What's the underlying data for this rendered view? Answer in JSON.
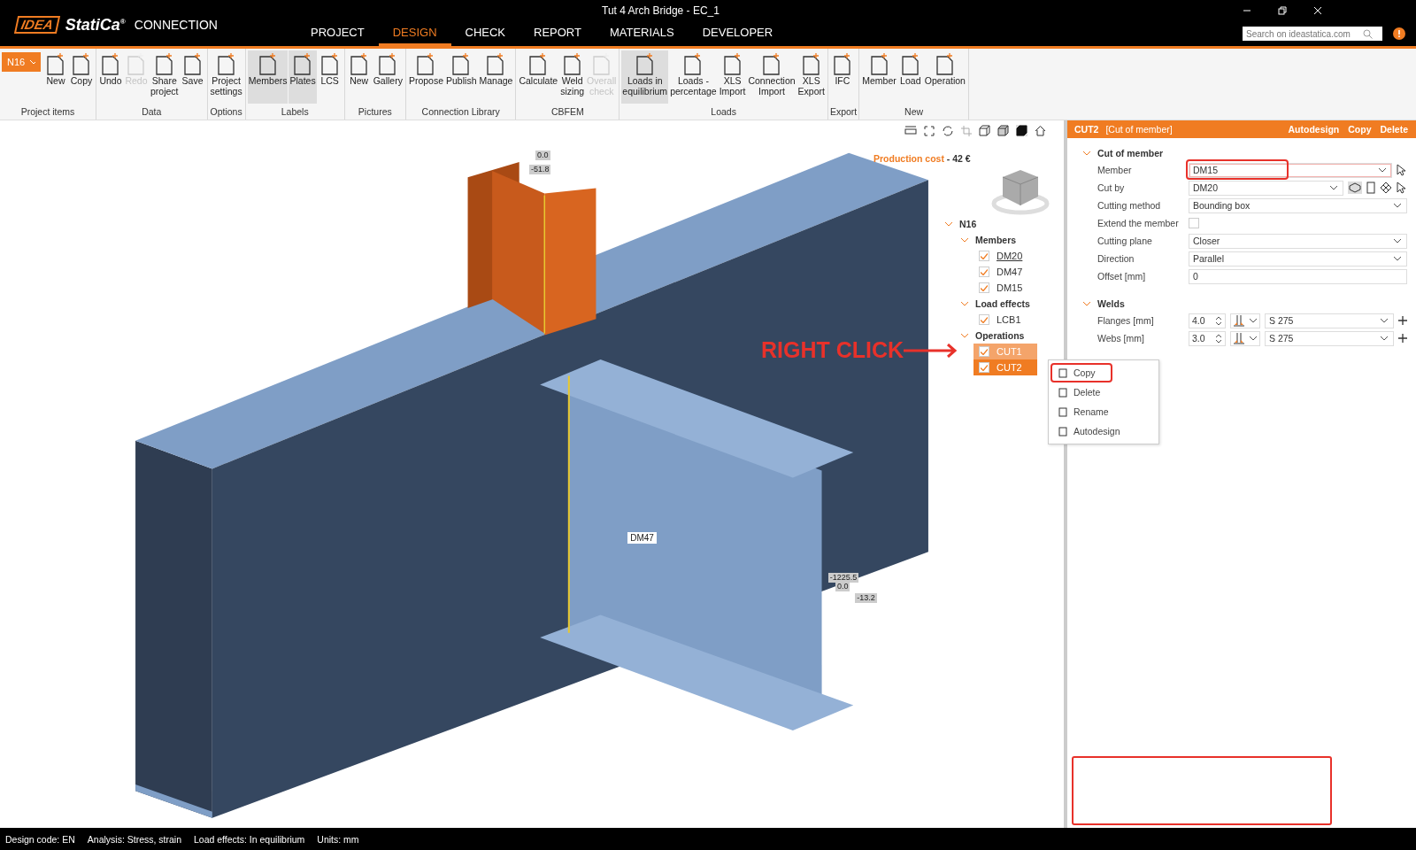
{
  "window": {
    "title": "Tut 4 Arch Bridge - EC_1",
    "logo": {
      "mark": "IDEA",
      "name": "StatiCa",
      "registered": "®",
      "product": "CONNECTION"
    }
  },
  "menu_tabs": [
    {
      "label": "PROJECT",
      "selected": false
    },
    {
      "label": "DESIGN",
      "selected": true
    },
    {
      "label": "CHECK",
      "selected": false
    },
    {
      "label": "REPORT",
      "selected": false
    },
    {
      "label": "MATERIALS",
      "selected": false
    },
    {
      "label": "DEVELOPER",
      "selected": false
    }
  ],
  "search": {
    "placeholder": "Search on ideastatica.com"
  },
  "ribbon": {
    "node": "N16",
    "groups": [
      {
        "label": "Project items",
        "buttons": [
          {
            "label": "New",
            "disabled": false,
            "selected": false
          },
          {
            "label": "Copy",
            "disabled": false,
            "selected": false
          }
        ]
      },
      {
        "label": "Data",
        "buttons": [
          {
            "label": "Undo",
            "disabled": false,
            "selected": false
          },
          {
            "label": "Redo",
            "disabled": true,
            "selected": false
          },
          {
            "label": "Share\nproject",
            "disabled": false,
            "selected": false
          },
          {
            "label": "Save",
            "disabled": false,
            "selected": false
          }
        ]
      },
      {
        "label": "Options",
        "buttons": [
          {
            "label": "Project\nsettings",
            "disabled": false,
            "selected": false
          }
        ]
      },
      {
        "label": "Labels",
        "buttons": [
          {
            "label": "Members",
            "disabled": false,
            "selected": true
          },
          {
            "label": "Plates",
            "disabled": false,
            "selected": true
          },
          {
            "label": "LCS",
            "disabled": false,
            "selected": false
          }
        ]
      },
      {
        "label": "Pictures",
        "buttons": [
          {
            "label": "New",
            "disabled": false,
            "selected": false
          },
          {
            "label": "Gallery",
            "disabled": false,
            "selected": false
          }
        ]
      },
      {
        "label": "Connection Library",
        "buttons": [
          {
            "label": "Propose",
            "disabled": false,
            "selected": false
          },
          {
            "label": "Publish",
            "disabled": false,
            "selected": false
          },
          {
            "label": "Manage",
            "disabled": false,
            "selected": false
          }
        ]
      },
      {
        "label": "CBFEM",
        "buttons": [
          {
            "label": "Calculate",
            "disabled": false,
            "selected": false
          },
          {
            "label": "Weld\nsizing",
            "disabled": false,
            "selected": false
          },
          {
            "label": "Overall\ncheck",
            "disabled": true,
            "selected": false
          }
        ]
      },
      {
        "label": "Loads",
        "buttons": [
          {
            "label": "Loads in\nequilibrium",
            "disabled": false,
            "selected": true
          },
          {
            "label": "Loads -\npercentage",
            "disabled": false,
            "selected": false
          },
          {
            "label": "XLS\nImport",
            "disabled": false,
            "selected": false
          },
          {
            "label": "Connection\nImport",
            "disabled": false,
            "selected": false
          },
          {
            "label": "XLS\nExport",
            "disabled": false,
            "selected": false
          }
        ]
      },
      {
        "label": "Export",
        "buttons": [
          {
            "label": "IFC",
            "disabled": false,
            "selected": false
          }
        ]
      },
      {
        "label": "New",
        "buttons": [
          {
            "label": "Member",
            "disabled": false,
            "selected": false
          },
          {
            "label": "Load",
            "disabled": false,
            "selected": false
          },
          {
            "label": "Operation",
            "disabled": false,
            "selected": false
          }
        ]
      }
    ]
  },
  "viewport": {
    "production_cost": {
      "label": "Production cost",
      "value": "- 42 €"
    },
    "labels": [
      {
        "kind": "dimension",
        "text": "0.0"
      },
      {
        "kind": "dimension",
        "text": "-51.8"
      },
      {
        "kind": "member",
        "text": "DM47"
      },
      {
        "kind": "dimension",
        "text": "-1225.5"
      },
      {
        "kind": "dimension",
        "text": "0.0"
      },
      {
        "kind": "dimension",
        "text": "-13.2"
      }
    ],
    "annotation": {
      "text": "RIGHT CLICK"
    }
  },
  "tree": {
    "label": "N16",
    "expanded": true,
    "groups": [
      {
        "label": "Members",
        "expanded": true,
        "items": [
          {
            "label": "DM20",
            "checked": true,
            "selected": false,
            "focused": false,
            "hovered": true
          },
          {
            "label": "DM47",
            "checked": true,
            "selected": false,
            "focused": false,
            "hovered": false
          },
          {
            "label": "DM15",
            "checked": true,
            "selected": false,
            "focused": false,
            "hovered": false
          }
        ]
      },
      {
        "label": "Load effects",
        "expanded": true,
        "items": [
          {
            "label": "LCB1",
            "checked": true,
            "selected": false,
            "focused": false,
            "hovered": false
          }
        ]
      },
      {
        "label": "Operations",
        "expanded": true,
        "items": [
          {
            "label": "CUT1",
            "checked": true,
            "selected": true,
            "focused": false,
            "hovered": false
          },
          {
            "label": "CUT2",
            "checked": true,
            "selected": true,
            "focused": true,
            "hovered": false
          }
        ]
      }
    ]
  },
  "context_menu": {
    "items": [
      {
        "label": "Copy",
        "highlighted": true
      },
      {
        "label": "Delete",
        "highlighted": false
      },
      {
        "label": "Rename",
        "highlighted": false
      },
      {
        "label": "Autodesign",
        "highlighted": false
      }
    ]
  },
  "panel": {
    "title": "CUT2",
    "subtitle": "[Cut of member]",
    "actions": [
      "Autodesign",
      "Copy",
      "Delete"
    ],
    "sections": [
      {
        "title": "Cut of member",
        "expanded": true,
        "rows": [
          {
            "kind": "select",
            "label": "Member",
            "value": "DM15",
            "highlighted": true,
            "tools": false
          },
          {
            "kind": "select",
            "label": "Cut by",
            "value": "DM20",
            "highlighted": false,
            "tools": true
          },
          {
            "kind": "select",
            "label": "Cutting method",
            "value": "Bounding box",
            "highlighted": false,
            "tools": false
          },
          {
            "kind": "checkbox",
            "label": "Extend the member",
            "checked": false
          },
          {
            "kind": "select",
            "label": "Cutting plane",
            "value": "Closer",
            "highlighted": false,
            "tools": false
          },
          {
            "kind": "select",
            "label": "Direction",
            "value": "Parallel",
            "highlighted": false,
            "tools": false
          },
          {
            "kind": "text",
            "label": "Offset [mm]",
            "value": "0"
          }
        ]
      },
      {
        "title": "Welds",
        "expanded": true,
        "rows": [
          {
            "kind": "weld",
            "label": "Flanges [mm]",
            "size": "4.0",
            "material": "S 275"
          },
          {
            "kind": "weld",
            "label": "Webs [mm]",
            "size": "3.0",
            "material": "S 275"
          }
        ]
      }
    ]
  },
  "status_bar": [
    "Design code: EN",
    "Analysis: Stress, strain",
    "Load effects: In equilibrium",
    "Units: mm"
  ]
}
